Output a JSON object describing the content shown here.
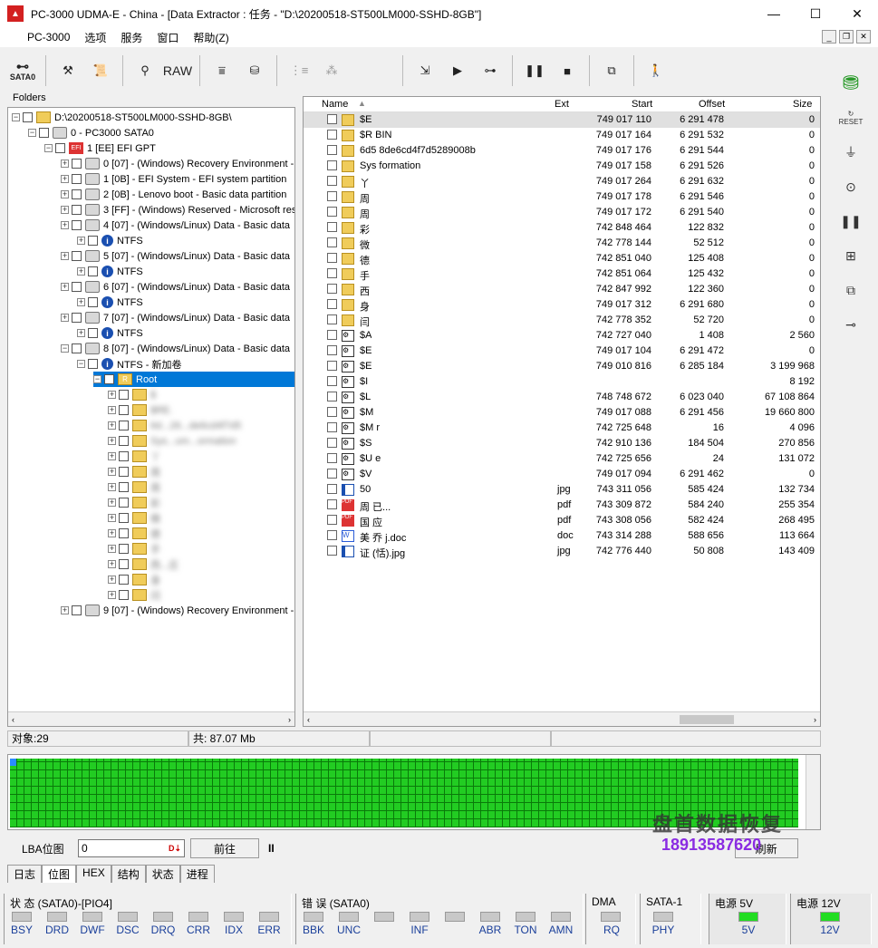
{
  "window": {
    "title": "PC-3000 UDMA-E - China - [Data Extractor : 任务 - \"D:\\20200518-ST500LM000-SSHD-8GB\"]",
    "icon_text": "▲",
    "min": "—",
    "max": "☐",
    "close": "✕"
  },
  "menu": [
    "PC-3000",
    "选项",
    "服务",
    "窗口",
    "帮助(Z)"
  ],
  "toolbar": {
    "sata": "SATA0",
    "raw": "RAW"
  },
  "folders": {
    "header": "Folders",
    "root": "D:\\20200518-ST500LM000-SSHD-8GB\\",
    "disk": "0 - PC3000 SATA0",
    "gpt": "1 [EE] EFI GPT",
    "parts": [
      "0 [07] - (Windows) Recovery Environment -",
      "1 [0B] - EFI System - EFI system partition",
      "2 [0B] - Lenovo boot - Basic data partition",
      "3 [FF] - (Windows) Reserved - Microsoft res",
      "4 [07] - (Windows/Linux) Data - Basic data",
      "NTFS",
      "5 [07] - (Windows/Linux) Data - Basic data",
      "NTFS",
      "6 [07] - (Windows/Linux) Data - Basic data",
      "NTFS",
      "7 [07] - (Windows/Linux) Data - Basic data",
      "NTFS",
      "8 [07] - (Windows/Linux) Data - Basic data",
      "NTFS - 新加卷",
      "Root"
    ],
    "root_children": [
      "$",
      "$RE.",
      "6d...26...de6cd4f7d5",
      "Sys...um...ormation",
      "丫",
      "周",
      "周",
      "彩",
      "微",
      "德",
      "手",
      "西...庄",
      "身",
      "闫"
    ],
    "last": "9 [07] - (Windows) Recovery Environment -"
  },
  "files": {
    "columns": {
      "name": "Name",
      "ext": "Ext",
      "start": "Start",
      "offset": "Offset",
      "size": "Size"
    },
    "rows": [
      {
        "name": "$E",
        "ext": "",
        "start": "749 017 110",
        "offset": "6 291 478",
        "size": "0",
        "t": "folder"
      },
      {
        "name": "$R    BIN",
        "ext": "",
        "start": "749 017 164",
        "offset": "6 291 532",
        "size": "0",
        "t": "folder"
      },
      {
        "name": "6d5        8de6cd4f7d5289008b",
        "ext": "",
        "start": "749 017 176",
        "offset": "6 291 544",
        "size": "0",
        "t": "folder"
      },
      {
        "name": "Sys         formation",
        "ext": "",
        "start": "749 017 158",
        "offset": "6 291 526",
        "size": "0",
        "t": "folder"
      },
      {
        "name": "丫",
        "ext": "",
        "start": "749 017 264",
        "offset": "6 291 632",
        "size": "0",
        "t": "folder"
      },
      {
        "name": "周",
        "ext": "",
        "start": "749 017 178",
        "offset": "6 291 546",
        "size": "0",
        "t": "folder"
      },
      {
        "name": "周",
        "ext": "",
        "start": "749 017 172",
        "offset": "6 291 540",
        "size": "0",
        "t": "folder"
      },
      {
        "name": "彩",
        "ext": "",
        "start": "742 848 464",
        "offset": "122 832",
        "size": "0",
        "t": "folder"
      },
      {
        "name": "微",
        "ext": "",
        "start": "742 778 144",
        "offset": "52 512",
        "size": "0",
        "t": "folder"
      },
      {
        "name": "德",
        "ext": "",
        "start": "742 851 040",
        "offset": "125 408",
        "size": "0",
        "t": "folder"
      },
      {
        "name": "手",
        "ext": "",
        "start": "742 851 064",
        "offset": "125 432",
        "size": "0",
        "t": "folder"
      },
      {
        "name": "西",
        "ext": "",
        "start": "742 847 992",
        "offset": "122 360",
        "size": "0",
        "t": "folder"
      },
      {
        "name": "身",
        "ext": "",
        "start": "749 017 312",
        "offset": "6 291 680",
        "size": "0",
        "t": "folder"
      },
      {
        "name": "闫",
        "ext": "",
        "start": "742 778 352",
        "offset": "52 720",
        "size": "0",
        "t": "folder"
      },
      {
        "name": "$A",
        "ext": "",
        "start": "742 727 040",
        "offset": "1 408",
        "size": "2 560",
        "t": "sys"
      },
      {
        "name": "$E",
        "ext": "",
        "start": "749 017 104",
        "offset": "6 291 472",
        "size": "0",
        "t": "sys"
      },
      {
        "name": "$E",
        "ext": "",
        "start": "749 010 816",
        "offset": "6 285 184",
        "size": "3 199 968",
        "t": "sys"
      },
      {
        "name": "$I",
        "ext": "",
        "start": "",
        "offset": "",
        "size": "8 192",
        "t": "sys"
      },
      {
        "name": "$L",
        "ext": "",
        "start": "748 748 672",
        "offset": "6 023 040",
        "size": "67 108 864",
        "t": "sys"
      },
      {
        "name": "$M",
        "ext": "",
        "start": "749 017 088",
        "offset": "6 291 456",
        "size": "19 660 800",
        "t": "sys"
      },
      {
        "name": "$M    r",
        "ext": "",
        "start": "742 725 648",
        "offset": "16",
        "size": "4 096",
        "t": "sys"
      },
      {
        "name": "$S",
        "ext": "",
        "start": "742 910 136",
        "offset": "184 504",
        "size": "270 856",
        "t": "sys"
      },
      {
        "name": "$U    e",
        "ext": "",
        "start": "742 725 656",
        "offset": "24",
        "size": "131 072",
        "t": "sys"
      },
      {
        "name": "$V",
        "ext": "",
        "start": "749 017 094",
        "offset": "6 291 462",
        "size": "0",
        "t": "sys"
      },
      {
        "name": "50",
        "ext": "jpg",
        "start": "743 311 056",
        "offset": "585 424",
        "size": "132 734",
        "t": "jpg"
      },
      {
        "name": "周          已...",
        "ext": "pdf",
        "start": "743 309 872",
        "offset": "584 240",
        "size": "255 354",
        "t": "pdf"
      },
      {
        "name": "国    应",
        "ext": "pdf",
        "start": "743 308 056",
        "offset": "582 424",
        "size": "268 495",
        "t": "pdf"
      },
      {
        "name": "美    乔            j.doc",
        "ext": "doc",
        "start": "743 314 288",
        "offset": "588 656",
        "size": "113 664",
        "t": "doc"
      },
      {
        "name": "证    (恬).jpg",
        "ext": "jpg",
        "start": "742 776 440",
        "offset": "50 808",
        "size": "143 409",
        "t": "jpg"
      }
    ]
  },
  "status": {
    "objects": "对象:29",
    "total": "共: 87.07 Mb"
  },
  "lba": {
    "label": "LBA位图",
    "value": "0",
    "forward": "前往",
    "pause": "II",
    "right_btn": "刷新"
  },
  "tabs": [
    "日志",
    "位图",
    "HEX",
    "结构",
    "状态",
    "进程"
  ],
  "bottom": {
    "status_title": "状 态 (SATA0)-[PIO4]",
    "status_leds": [
      "BSY",
      "DRD",
      "DWF",
      "DSC",
      "DRQ",
      "CRR",
      "IDX",
      "ERR"
    ],
    "error_title": "错 误 (SATA0)",
    "error_leds": [
      "BBK",
      "UNC",
      "",
      "INF",
      "",
      "ABR",
      "TON",
      "AMN"
    ],
    "dma_title": "DMA",
    "dma_led": "RQ",
    "sata_title": "SATA-1",
    "sata_led": "PHY",
    "p5_title": "电源 5V",
    "p5_led": "5V",
    "p12_title": "电源 12V",
    "p12_led": "12V"
  },
  "watermark": {
    "line1": "盘首数据恢复",
    "line2": "18913587620"
  }
}
